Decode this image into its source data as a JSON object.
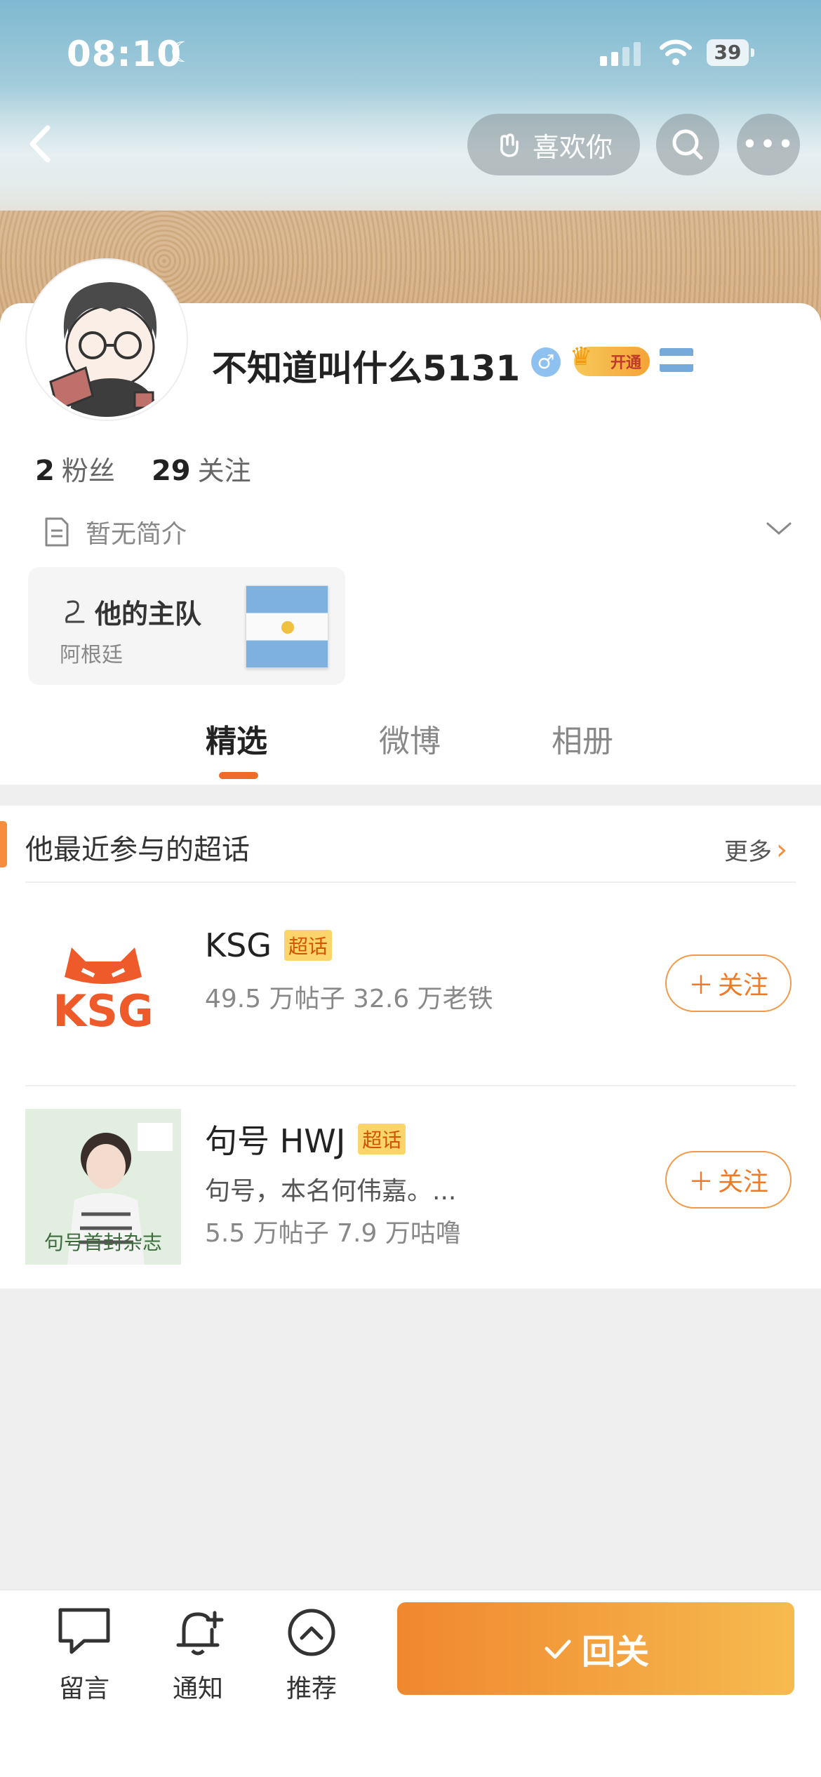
{
  "status_bar": {
    "time": "08:10",
    "battery": "39"
  },
  "nav": {
    "like_label": "喜欢你"
  },
  "profile": {
    "name": "不知道叫什么5131",
    "vip_label": "开通",
    "fans_count": "2",
    "fans_label": "粉丝",
    "following_count": "29",
    "following_label": "关注",
    "bio": "暂无简介",
    "team_title": "他的主队",
    "team_name": "阿根廷"
  },
  "tabs": [
    "精选",
    "微博",
    "相册"
  ],
  "section": {
    "title": "他最近参与的超话",
    "more": "更多",
    "items": [
      {
        "thumb_text": "KSG",
        "title": "KSG",
        "badge": "超话",
        "desc": "",
        "stats": "49.5 万帖子 32.6 万老铁",
        "follow": "关注"
      },
      {
        "thumb_text": "句号首封杂志",
        "title": "句号 HWJ",
        "badge": "超话",
        "desc": "句号，本名何伟嘉。...",
        "stats": "5.5 万帖子 7.9 万咕噜",
        "follow": "关注"
      }
    ]
  },
  "bottom_bar": {
    "message": "留言",
    "notify": "通知",
    "recommend": "推荐",
    "follow_back": "回关"
  },
  "colors": {
    "accent": "#f07a26",
    "follow_back_start": "#f0872f",
    "follow_back_end": "#f6bb4f"
  }
}
